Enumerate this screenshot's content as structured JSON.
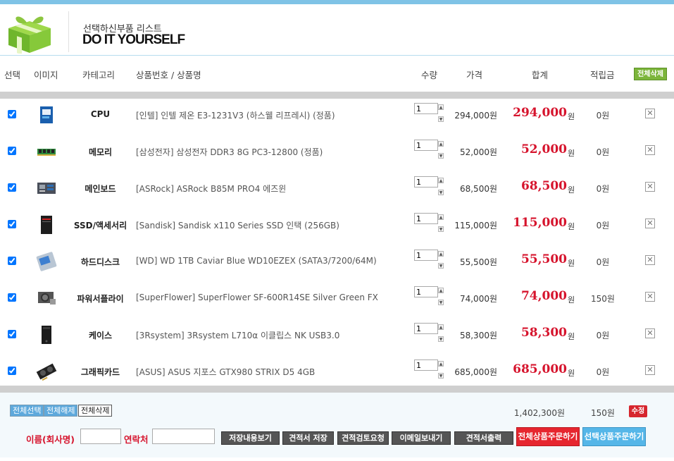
{
  "header": {
    "subtitle": "선택하신부품 리스트",
    "title": "DO IT YOURSELF"
  },
  "columns": {
    "select": "선택",
    "image": "이미지",
    "category": "카테고리",
    "product": "상품번호 / 상품명",
    "quantity": "수량",
    "price": "가격",
    "total": "합계",
    "points": "적립금",
    "delete_all": "전체삭제"
  },
  "items": [
    {
      "category": "CPU",
      "product": "[인텔] 인텔 제온 E3-1231V3 (하스웰 리프레시) (정품)",
      "qty": "1",
      "price": "294,000원",
      "total": "294,000",
      "won": "원",
      "points": "0원",
      "checked": true,
      "thumb": "cpu"
    },
    {
      "category": "메모리",
      "product": "[삼성전자] 삼성전자 DDR3 8G PC3-12800 (정품)",
      "qty": "1",
      "price": "52,000원",
      "total": "52,000",
      "won": "원",
      "points": "0원",
      "checked": true,
      "thumb": "ram"
    },
    {
      "category": "메인보드",
      "product": "[ASRock] ASRock B85M PRO4 에즈윈",
      "qty": "1",
      "price": "68,500원",
      "total": "68,500",
      "won": "원",
      "points": "0원",
      "checked": true,
      "thumb": "board"
    },
    {
      "category": "SSD/액세서리",
      "product": "[Sandisk] Sandisk x110 Series SSD 인택 (256GB)",
      "qty": "1",
      "price": "115,000원",
      "total": "115,000",
      "won": "원",
      "points": "0원",
      "checked": true,
      "thumb": "ssd"
    },
    {
      "category": "하드디스크",
      "product": "[WD] WD 1TB Caviar Blue WD10EZEX (SATA3/7200/64M)",
      "qty": "1",
      "price": "55,500원",
      "total": "55,500",
      "won": "원",
      "points": "0원",
      "checked": true,
      "thumb": "hdd"
    },
    {
      "category": "파워서플라이",
      "product": "[SuperFlower] SuperFlower SF-600R14SE Silver Green FX",
      "qty": "1",
      "price": "74,000원",
      "total": "74,000",
      "won": "원",
      "points": "150원",
      "checked": true,
      "thumb": "psu"
    },
    {
      "category": "케이스",
      "product": "[3Rsystem] 3Rsystem L710α 이클립스 NK USB3.0",
      "qty": "1",
      "price": "58,300원",
      "total": "58,300",
      "won": "원",
      "points": "0원",
      "checked": true,
      "thumb": "case"
    },
    {
      "category": "그래픽카드",
      "product": "[ASUS] ASUS 지포스 GTX980 STRIX D5 4GB",
      "qty": "1",
      "price": "685,000원",
      "total": "685,000",
      "won": "원",
      "points": "0원",
      "checked": true,
      "thumb": "gpu"
    }
  ],
  "summary": {
    "select_all": "전체선택",
    "deselect_all": "전체해제",
    "delete_all": "전체삭제",
    "total": "1,402,300원",
    "points": "150원",
    "edit": "수정"
  },
  "form": {
    "name_label": "이름(회사명)",
    "contact_label": "연락처",
    "buttons": [
      "저장내용보기",
      "견적서 저장",
      "견적검토요청",
      "이메일보내기",
      "견적서출력"
    ],
    "order_all": "전체상품주문하기",
    "order_selected": "선택상품주문하기"
  },
  "colors": {
    "accent_red": "#d6142d",
    "accent_green": "#7cb53b",
    "accent_blue": "#5ea9dc"
  }
}
